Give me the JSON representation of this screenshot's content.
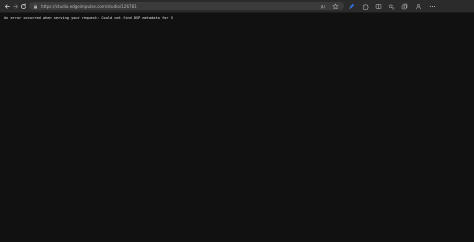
{
  "browser": {
    "url": "https://studio.edgeimpulse.com/studio/126781",
    "icons": {
      "back": "back-arrow-icon",
      "forward": "forward-arrow-icon",
      "refresh": "refresh-icon",
      "lock": "lock-icon",
      "read_aloud": "read-aloud-icon",
      "favorite": "star-icon",
      "extension_active": "pen-extension-icon",
      "extensions": "puzzle-icon",
      "split_screen": "split-screen-icon",
      "favorites": "favorites-icon",
      "collections": "collections-icon",
      "profile": "profile-icon",
      "more": "more-icon"
    }
  },
  "page": {
    "error_message": "An error occurred when serving your request: Could not find DSP metadata for 3"
  },
  "colors": {
    "toolbar_bg": "#2b2b2b",
    "address_bg": "#3b3b3b",
    "page_bg": "#111111",
    "text": "#e6e6e6",
    "accent_extension": "#2f6fd6"
  }
}
